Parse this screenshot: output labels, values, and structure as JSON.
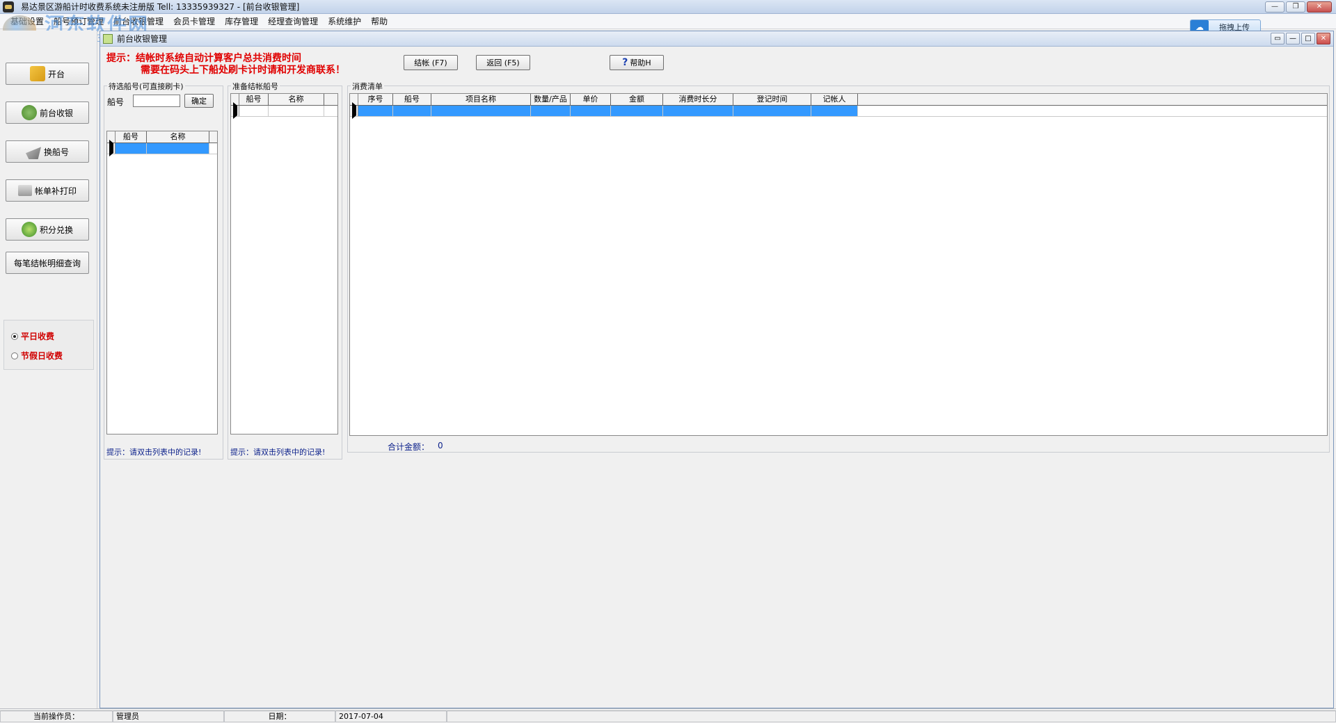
{
  "window": {
    "title": "易达景区游船计时收费系统未注册版 Tell: 13335939327 - [前台收银管理]",
    "minimize": "—",
    "restore": "❐",
    "close": "✕"
  },
  "menu": [
    "基础设置",
    "船号预订管理",
    "前台收银管理",
    "会员卡管理",
    "库存管理",
    "经理查询管理",
    "系统维护",
    "帮助"
  ],
  "watermark": {
    "brand": "河东软件网",
    "url": "www.pc0359.cn"
  },
  "upload_widget": {
    "label": "拖拽上传",
    "icon": "cloud-icon"
  },
  "sidebar": {
    "buttons": [
      {
        "label": "开台",
        "icon": "folder-icon"
      },
      {
        "label": "前台收银",
        "icon": "money-bag-icon"
      },
      {
        "label": "换船号",
        "icon": "boat-swap-icon"
      },
      {
        "label": "帐单补打印",
        "icon": "printer-icon"
      },
      {
        "label": "积分兑换",
        "icon": "points-icon"
      },
      {
        "label": "每笔结帐明细查询",
        "icon": ""
      }
    ],
    "modes": [
      {
        "label": "平日收费",
        "selected": true
      },
      {
        "label": "节假日收费",
        "selected": false
      }
    ]
  },
  "child": {
    "title": "前台收银管理",
    "tip_line1": "提示：结帐时系统自动计算客户总共消费时间",
    "tip_line2": "需要在码头上下船处刷卡计时请和开发商联系！",
    "actions": {
      "checkout": "结帐 (F7)",
      "back": "返回 (F5)",
      "help": "帮助H"
    }
  },
  "pending": {
    "legend": "待选船号(可直接刷卡)",
    "field_label": "船号",
    "field_value": "",
    "confirm": "确定",
    "columns": [
      "船号",
      "名称"
    ],
    "hint": "提示：请双击列表中的记录!"
  },
  "ready": {
    "legend": "准备结帐船号",
    "columns": [
      "船号",
      "名称"
    ],
    "hint": "提示：请双击列表中的记录!"
  },
  "consumption": {
    "legend": "消费清单",
    "columns": [
      "序号",
      "船号",
      "项目名称",
      "数量/产品",
      "单价",
      "金额",
      "消费时长分",
      "登记时间",
      "记帐人"
    ],
    "total_label": "合计金额：",
    "total_value": "0"
  },
  "status": {
    "operator_label": "当前操作员：",
    "operator_value": "管理员",
    "date_label": "日期：",
    "date_value": "2017-07-04"
  },
  "colors": {
    "selection": "#3399ff",
    "tip_red": "#e00000",
    "hint_blue": "#0a1f8a"
  }
}
